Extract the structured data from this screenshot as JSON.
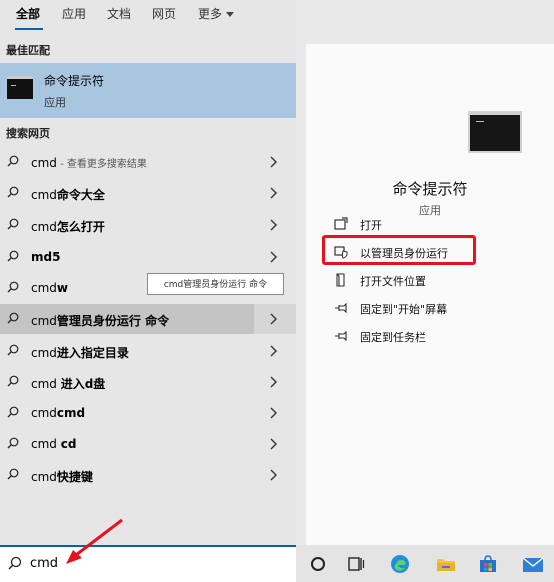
{
  "tabs": [
    {
      "label": "全部",
      "active": true
    },
    {
      "label": "应用"
    },
    {
      "label": "文档"
    },
    {
      "label": "网页"
    },
    {
      "label": "更多"
    }
  ],
  "best_match": {
    "section": "最佳匹配",
    "title": "命令提示符",
    "subtitle": "应用"
  },
  "web": {
    "section": "搜索网页",
    "results": [
      {
        "prefix": "cmd",
        "bold": "",
        "suffix": " - 查看更多搜索结果"
      },
      {
        "prefix": "cmd",
        "bold": "命令大全",
        "suffix": ""
      },
      {
        "prefix": "cmd",
        "bold": "怎么打开",
        "suffix": ""
      },
      {
        "prefix": "",
        "bold": "md5",
        "suffix": ""
      },
      {
        "prefix": "cmd",
        "bold": "w",
        "suffix": ""
      },
      {
        "prefix": "cmd",
        "bold": "管理员身份运行 命令",
        "suffix": ""
      },
      {
        "prefix": "cmd",
        "bold": "进入指定目录",
        "suffix": ""
      },
      {
        "prefix": "cmd ",
        "bold": "进入d盘",
        "suffix": ""
      },
      {
        "prefix": "cmd",
        "bold": "cmd",
        "suffix": ""
      },
      {
        "prefix": "cmd ",
        "bold": "cd",
        "suffix": ""
      },
      {
        "prefix": "cmd",
        "bold": "快捷键",
        "suffix": ""
      }
    ]
  },
  "tooltip": "cmd管理员身份运行 命令",
  "preview": {
    "title": "命令提示符",
    "subtitle": "应用",
    "actions": [
      {
        "label": "打开",
        "icon": "open-icon"
      },
      {
        "label": "以管理员身份运行",
        "icon": "shield-icon"
      },
      {
        "label": "打开文件位置",
        "icon": "file-location-icon"
      },
      {
        "label": "固定到\"开始\"屏幕",
        "icon": "pin-icon"
      },
      {
        "label": "固定到任务栏",
        "icon": "pin-icon"
      }
    ]
  },
  "search": {
    "value": "cmd"
  },
  "taskbar": {
    "icons": [
      "cortana-icon",
      "task-view-icon",
      "edge-icon",
      "file-explorer-icon",
      "store-icon",
      "mail-icon"
    ]
  },
  "colors": {
    "accent": "#0063b1",
    "highlight": "#a9c6e1",
    "annotation": "#e3141e"
  }
}
